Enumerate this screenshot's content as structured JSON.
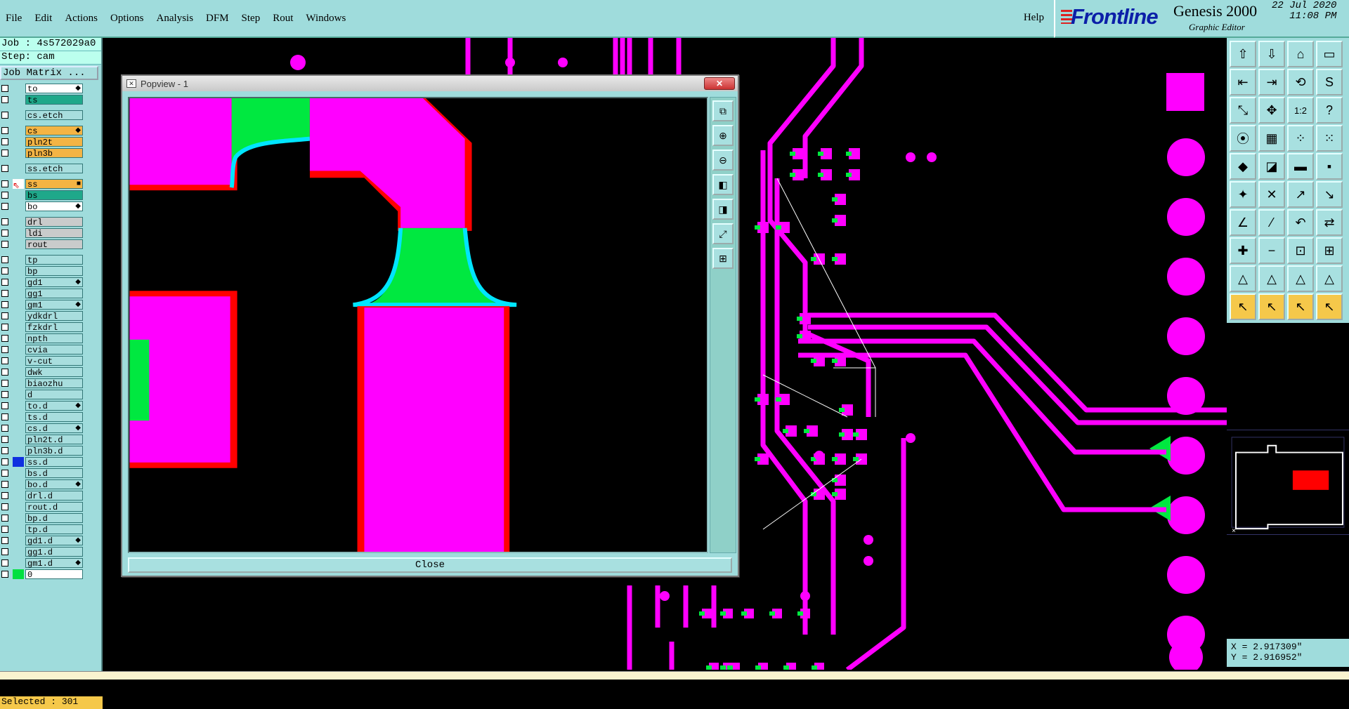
{
  "menu": [
    "File",
    "Edit",
    "Actions",
    "Options",
    "Analysis",
    "DFM",
    "Step",
    "Rout",
    "Windows"
  ],
  "help_label": "Help",
  "brand": {
    "logo": "Frontline",
    "product": "Genesis 2000",
    "subtitle": "Graphic Editor",
    "date": "22 Jul 2020",
    "time": "11:08 PM"
  },
  "job_label": "Job : 4s572029a0",
  "step_label": "Step: cam",
  "matrix_button": "Job Matrix ...",
  "layers": [
    {
      "name": "to",
      "style": "bright",
      "mark": "◆"
    },
    {
      "name": "ts",
      "style": "teal"
    },
    {
      "name": "cs.etch",
      "style": "",
      "gap": true
    },
    {
      "name": "cs",
      "style": "orange",
      "mark": "◆",
      "gap": true
    },
    {
      "name": "pln2t",
      "style": "orange"
    },
    {
      "name": "pln3b",
      "style": "orange"
    },
    {
      "name": "ss.etch",
      "style": "",
      "gap": true
    },
    {
      "name": "ss",
      "style": "orange",
      "mark": "■",
      "gap": true,
      "work": true
    },
    {
      "name": "bs",
      "style": "teal"
    },
    {
      "name": "bo",
      "style": "bright",
      "mark": "◆"
    },
    {
      "name": "drl",
      "style": "grey",
      "gap": true
    },
    {
      "name": "ldi",
      "style": "grey"
    },
    {
      "name": "rout",
      "style": "grey"
    },
    {
      "name": "tp",
      "style": "",
      "gap": true
    },
    {
      "name": "bp",
      "style": ""
    },
    {
      "name": "gd1",
      "style": "",
      "mark": "◆"
    },
    {
      "name": "gg1",
      "style": ""
    },
    {
      "name": "gm1",
      "style": "",
      "mark": "◆"
    },
    {
      "name": "ydkdrl",
      "style": ""
    },
    {
      "name": "fzkdrl",
      "style": ""
    },
    {
      "name": "npth",
      "style": ""
    },
    {
      "name": "cvia",
      "style": ""
    },
    {
      "name": "v-cut",
      "style": ""
    },
    {
      "name": "dwk",
      "style": ""
    },
    {
      "name": "biaozhu",
      "style": ""
    },
    {
      "name": "d",
      "style": ""
    },
    {
      "name": "to.d",
      "style": "",
      "mark": "◆"
    },
    {
      "name": "ts.d",
      "style": ""
    },
    {
      "name": "cs.d",
      "style": "",
      "mark": "◆"
    },
    {
      "name": "pln2t.d",
      "style": ""
    },
    {
      "name": "pln3b.d",
      "style": ""
    },
    {
      "name": "ss.d",
      "style": "",
      "swatch": "#1030e0"
    },
    {
      "name": "bs.d",
      "style": ""
    },
    {
      "name": "bo.d",
      "style": "",
      "mark": "◆"
    },
    {
      "name": "drl.d",
      "style": ""
    },
    {
      "name": "rout.d",
      "style": ""
    },
    {
      "name": "bp.d",
      "style": ""
    },
    {
      "name": "tp.d",
      "style": ""
    },
    {
      "name": "gd1.d",
      "style": "",
      "mark": "◆"
    },
    {
      "name": "gg1.d",
      "style": ""
    },
    {
      "name": "gm1.d",
      "style": "",
      "mark": "◆"
    },
    {
      "name": "0",
      "style": "bright",
      "swatch": "#00e040"
    }
  ],
  "selected_label": "Selected : 301",
  "popview": {
    "title": "Popview - 1",
    "close_label": "Close"
  },
  "coords": {
    "x": "X = 2.917309\"",
    "y": "Y = 2.916952\""
  },
  "colors": {
    "copper": "#ff00ff",
    "teardrop": "#00e840",
    "clearance": "#ff0000",
    "outline": "#00e5ff",
    "panel": "#9fdcdc",
    "highlight": "#f5c84a"
  },
  "toolbar_icons": [
    "layer-up-icon",
    "layer-down-icon",
    "home-icon",
    "window-icon",
    "pan-left-icon",
    "pan-right-icon",
    "fit-icon",
    "scroll-icon",
    "zoom-fit-icon",
    "zoom-center-icon",
    "ratio-icon",
    "query-icon",
    "measure-icon",
    "grid-icon",
    "snap-icon",
    "snap2-icon",
    "select-icon",
    "draw-icon",
    "line-icon",
    "pad-icon",
    "route-icon",
    "cross-icon",
    "connect-icon",
    "move-icon",
    "angle-icon",
    "slope-icon",
    "undo-icon",
    "flip-icon",
    "add-icon",
    "minus-icon",
    "align-icon",
    "group-icon",
    "tri1-icon",
    "tri2-icon",
    "tri3-icon",
    "tri4-icon",
    "pointer1-icon",
    "pointer2-icon",
    "pointer3-icon",
    "pointer4-icon"
  ]
}
